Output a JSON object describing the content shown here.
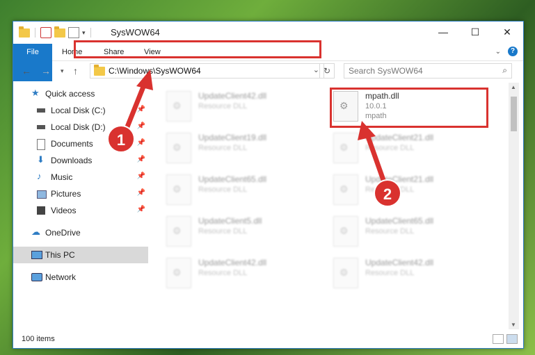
{
  "window": {
    "title": "SysWOW64"
  },
  "ribbon": {
    "tabs": [
      "File",
      "Home",
      "Share",
      "View"
    ]
  },
  "address": {
    "path": "C:\\Windows\\SysWOW64"
  },
  "search": {
    "placeholder": "Search SysWOW64"
  },
  "nav": {
    "items": [
      {
        "label": "Quick access",
        "icon": "star-icon"
      },
      {
        "label": "Local Disk (C:)",
        "icon": "drive-icon"
      },
      {
        "label": "Local Disk (D:)",
        "icon": "drive-icon"
      },
      {
        "label": "Documents",
        "icon": "document-icon"
      },
      {
        "label": "Downloads",
        "icon": "download-icon"
      },
      {
        "label": "Music",
        "icon": "music-icon"
      },
      {
        "label": "Pictures",
        "icon": "pictures-icon"
      },
      {
        "label": "Videos",
        "icon": "video-icon"
      },
      {
        "label": "OneDrive",
        "icon": "cloud-icon"
      },
      {
        "label": "This PC",
        "icon": "pc-icon"
      },
      {
        "label": "Network",
        "icon": "network-icon"
      }
    ]
  },
  "files": [
    {
      "name": "UpdateClient42.dll",
      "sub1": "Resource DLL",
      "sub2": ""
    },
    {
      "name": "mpath.dll",
      "sub1": "10.0.1",
      "sub2": "mpath"
    },
    {
      "name": "UpdateClient19.dll",
      "sub1": "Resource DLL",
      "sub2": ""
    },
    {
      "name": "UpdateClient21.dll",
      "sub1": "Resource DLL",
      "sub2": ""
    },
    {
      "name": "UpdateClient65.dll",
      "sub1": "Resource DLL",
      "sub2": ""
    },
    {
      "name": "UpdateClient21.dll",
      "sub1": "Resource DLL",
      "sub2": ""
    },
    {
      "name": "UpdateClient5.dll",
      "sub1": "Resource DLL",
      "sub2": ""
    },
    {
      "name": "UpdateClient65.dll",
      "sub1": "Resource DLL",
      "sub2": ""
    },
    {
      "name": "UpdateClient42.dll",
      "sub1": "Resource DLL",
      "sub2": ""
    },
    {
      "name": "UpdateClient42.dll",
      "sub1": "Resource DLL",
      "sub2": ""
    }
  ],
  "status": {
    "count": "100 items"
  },
  "badges": [
    "1",
    "2"
  ],
  "colors": {
    "accent": "#1979ca",
    "annotation": "#d9322f"
  }
}
